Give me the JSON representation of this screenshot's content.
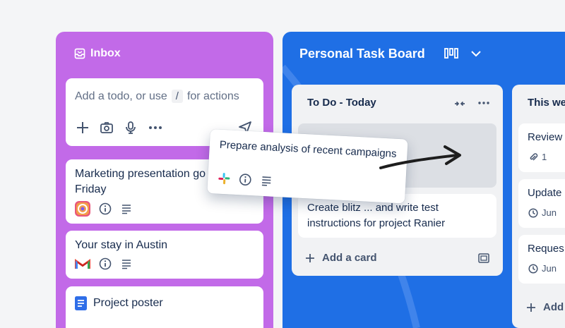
{
  "inbox": {
    "title": "Inbox",
    "composer": {
      "placeholder_before": "Add a todo, or use",
      "shortcut": "/",
      "placeholder_after": "for actions"
    },
    "cards": [
      {
        "title": "Marketing presentation go up to Friday"
      },
      {
        "title": "Your stay in Austin"
      },
      {
        "title": "Project poster"
      }
    ]
  },
  "dragged_card": {
    "title": "Prepare analysis of recent campaigns"
  },
  "board": {
    "title": "Personal Task Board",
    "lists": [
      {
        "title": "To Do - Today",
        "cards": [
          {
            "title": "Create blitz ... and write test instructions for project Ranier"
          }
        ],
        "add_label": "Add a card"
      },
      {
        "title": "This we",
        "cards": [
          {
            "title": "Review",
            "attachments": "1"
          },
          {
            "title": "Update",
            "date": "Jun"
          },
          {
            "title": "Reques",
            "date": "Jun"
          }
        ],
        "add_label": "Add"
      }
    ]
  },
  "colors": {
    "inbox_bg": "#c26ae8",
    "board_bg": "#1f6fe5",
    "page_bg": "#f4f5f7"
  }
}
